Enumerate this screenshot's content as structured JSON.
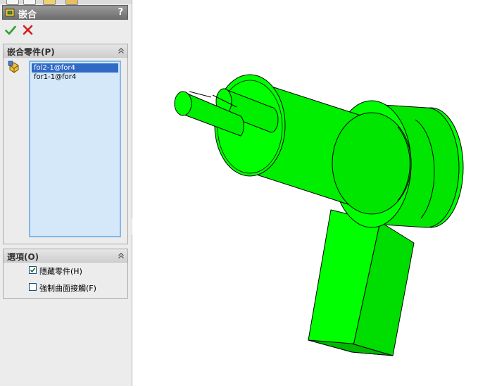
{
  "panel": {
    "title": "嵌合",
    "help_label": "?"
  },
  "components_group": {
    "title": "嵌合零件(P)",
    "items": [
      {
        "label": "fol2-1@for4",
        "selected": true
      },
      {
        "label": "for1-1@for4",
        "selected": false
      }
    ]
  },
  "options_group": {
    "title": "選項(O)",
    "options": [
      {
        "label": "隱藏零件(H)",
        "checked": true
      },
      {
        "label": "強制曲面接觸(F)",
        "checked": false
      }
    ]
  },
  "colors": {
    "model_green": "#00ff00",
    "model_shade": "#00cc00",
    "model_dark": "#009a00",
    "selection_blue": "#316ac5",
    "list_background": "#d4e8fa"
  }
}
